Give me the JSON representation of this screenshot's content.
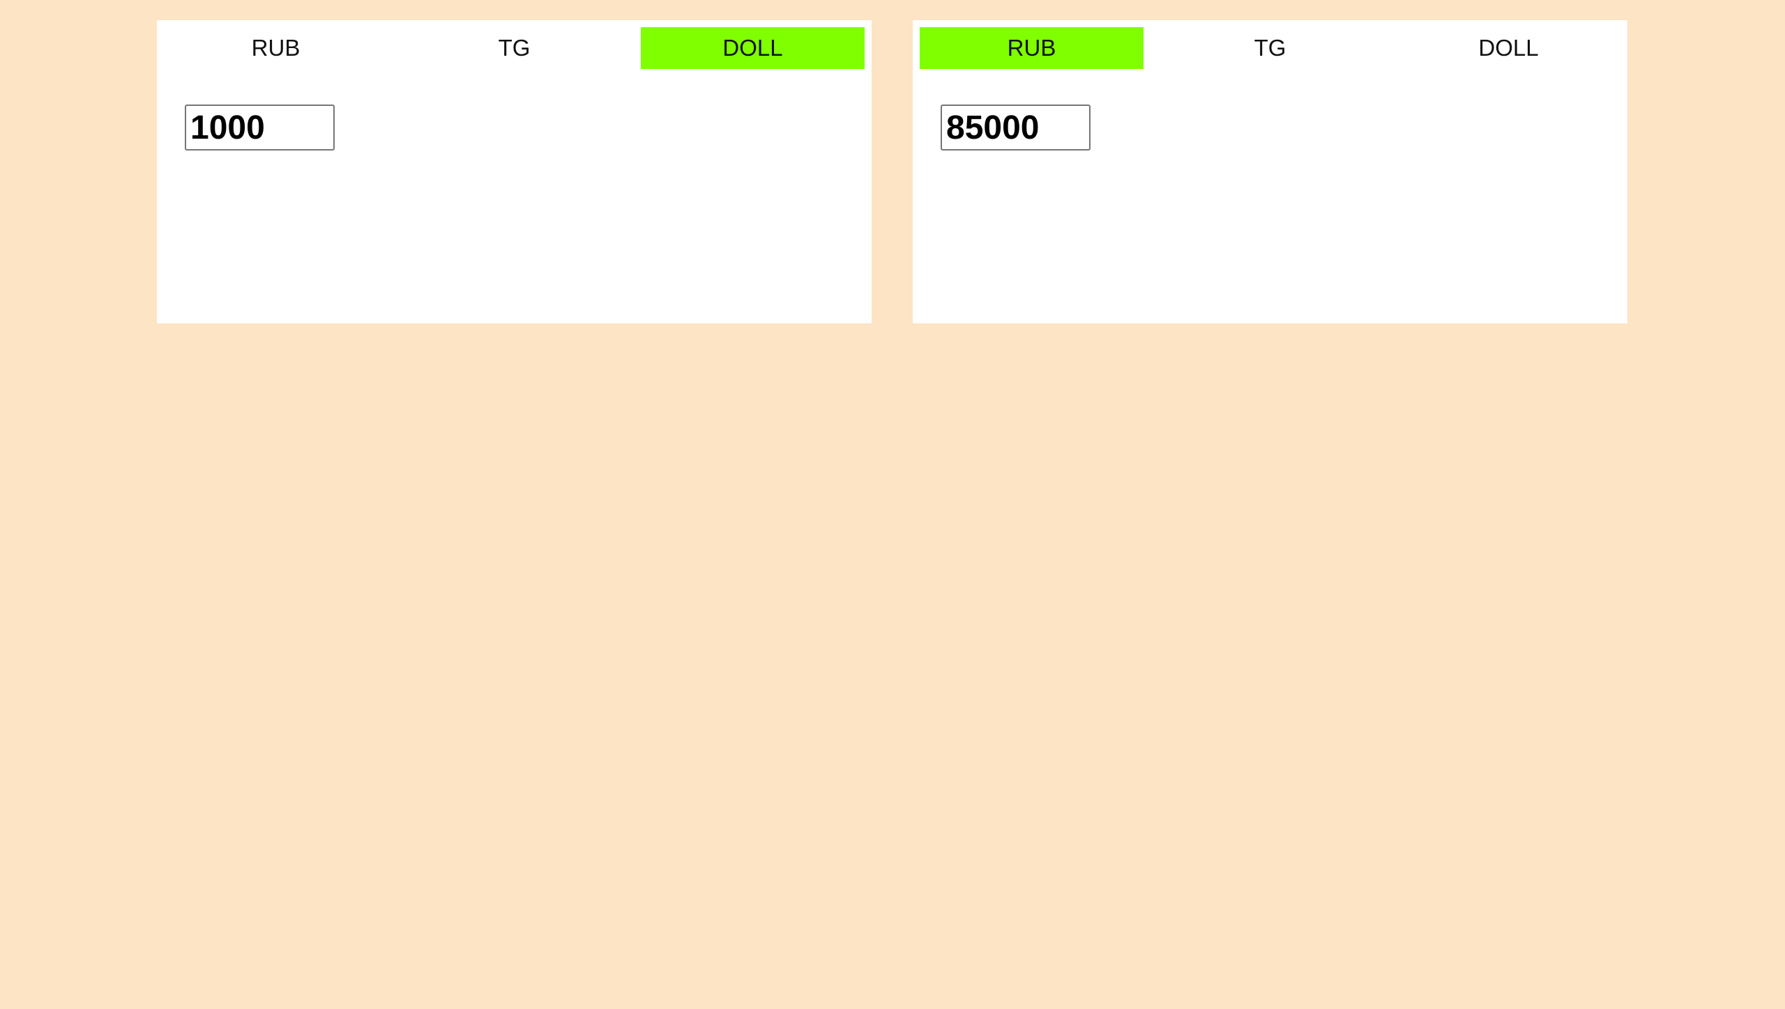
{
  "colors": {
    "page_background": "#fde4c5",
    "panel_background": "#ffffff",
    "active_tab": "#80ff00"
  },
  "converters": [
    {
      "tabs": [
        {
          "label": "RUB",
          "active": false
        },
        {
          "label": "TG",
          "active": false
        },
        {
          "label": "DOLL",
          "active": true
        }
      ],
      "amount": "1000"
    },
    {
      "tabs": [
        {
          "label": "RUB",
          "active": true
        },
        {
          "label": "TG",
          "active": false
        },
        {
          "label": "DOLL",
          "active": false
        }
      ],
      "amount": "85000"
    }
  ]
}
